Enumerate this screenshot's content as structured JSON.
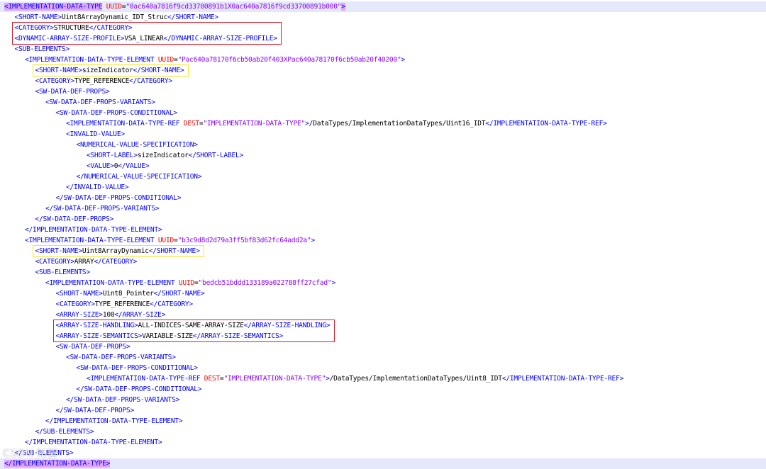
{
  "lines": [
    {
      "indent": 0,
      "highlight": true,
      "parts": [
        {
          "t": "ptag",
          "v": "<IMPLEMENTATION-DATA-TYPE"
        },
        {
          "t": "txt",
          "v": " "
        },
        {
          "t": "attr",
          "v": "UUID"
        },
        {
          "t": "eq",
          "v": "="
        },
        {
          "t": "val",
          "v": "\"0ac640a7816f9cd33700891b1X0ac640a7816f9cd33700891b000\""
        },
        {
          "t": "ptag",
          "v": ">"
        }
      ]
    },
    {
      "indent": 1,
      "parts": [
        {
          "t": "tag",
          "v": "<SHORT-NAME>"
        },
        {
          "t": "txt",
          "v": "Uint8ArrayDynamic_IDT_Struc"
        },
        {
          "t": "tag",
          "v": "</SHORT-NAME>"
        }
      ]
    },
    {
      "indent": 1,
      "parts": [
        {
          "t": "tag",
          "v": "<CATEGORY>"
        },
        {
          "t": "txt",
          "v": "STRUCTURE"
        },
        {
          "t": "tag",
          "v": "</CATEGORY>"
        }
      ]
    },
    {
      "indent": 1,
      "parts": [
        {
          "t": "tag",
          "v": "<DYNAMIC-ARRAY-SIZE-PROFILE>"
        },
        {
          "t": "txt",
          "v": "VSA_LINEAR"
        },
        {
          "t": "tag",
          "v": "</DYNAMIC-ARRAY-SIZE-PROFILE>"
        }
      ]
    },
    {
      "indent": 1,
      "parts": [
        {
          "t": "tag",
          "v": "<SUB-ELEMENTS>"
        }
      ]
    },
    {
      "indent": 2,
      "parts": [
        {
          "t": "tag",
          "v": "<IMPLEMENTATION-DATA-TYPE-ELEMENT"
        },
        {
          "t": "txt",
          "v": " "
        },
        {
          "t": "attr",
          "v": "UUID"
        },
        {
          "t": "eq",
          "v": "="
        },
        {
          "t": "val",
          "v": "\"Pac640a78170f6cb50ab20f403XPac640a78170f6cb50ab20f40200\""
        },
        {
          "t": "tag",
          "v": ">"
        }
      ]
    },
    {
      "indent": 3,
      "parts": [
        {
          "t": "tag",
          "v": "<SHORT-NAME>"
        },
        {
          "t": "txt",
          "v": "sizeIndicator"
        },
        {
          "t": "tag",
          "v": "</SHORT-NAME>"
        }
      ]
    },
    {
      "indent": 3,
      "parts": [
        {
          "t": "tag",
          "v": "<CATEGORY>"
        },
        {
          "t": "txt",
          "v": "TYPE_REFERENCE"
        },
        {
          "t": "tag",
          "v": "</CATEGORY>"
        }
      ]
    },
    {
      "indent": 3,
      "parts": [
        {
          "t": "tag",
          "v": "<SW-DATA-DEF-PROPS>"
        }
      ]
    },
    {
      "indent": 4,
      "parts": [
        {
          "t": "tag",
          "v": "<SW-DATA-DEF-PROPS-VARIANTS>"
        }
      ]
    },
    {
      "indent": 5,
      "parts": [
        {
          "t": "tag",
          "v": "<SW-DATA-DEF-PROPS-CONDITIONAL>"
        }
      ]
    },
    {
      "indent": 6,
      "parts": [
        {
          "t": "tag",
          "v": "<IMPLEMENTATION-DATA-TYPE-REF"
        },
        {
          "t": "txt",
          "v": " "
        },
        {
          "t": "attr",
          "v": "DEST"
        },
        {
          "t": "eq",
          "v": "="
        },
        {
          "t": "val",
          "v": "\"IMPLEMENTATION-DATA-TYPE\""
        },
        {
          "t": "tag",
          "v": ">"
        },
        {
          "t": "txt",
          "v": "/DataTypes/ImplementationDataTypes/Uint16_IDT"
        },
        {
          "t": "tag",
          "v": "</IMPLEMENTATION-DATA-TYPE-REF>"
        }
      ]
    },
    {
      "indent": 6,
      "parts": [
        {
          "t": "tag",
          "v": "<INVALID-VALUE>"
        }
      ]
    },
    {
      "indent": 7,
      "parts": [
        {
          "t": "tag",
          "v": "<NUMERICAL-VALUE-SPECIFICATION>"
        }
      ]
    },
    {
      "indent": 8,
      "parts": [
        {
          "t": "tag",
          "v": "<SHORT-LABEL>"
        },
        {
          "t": "txt",
          "v": "sizeIndicator"
        },
        {
          "t": "tag",
          "v": "</SHORT-LABEL>"
        }
      ]
    },
    {
      "indent": 8,
      "parts": [
        {
          "t": "tag",
          "v": "<VALUE>"
        },
        {
          "t": "txt",
          "v": "0"
        },
        {
          "t": "tag",
          "v": "</VALUE>"
        }
      ]
    },
    {
      "indent": 7,
      "parts": [
        {
          "t": "tag",
          "v": "</NUMERICAL-VALUE-SPECIFICATION>"
        }
      ]
    },
    {
      "indent": 6,
      "parts": [
        {
          "t": "tag",
          "v": "</INVALID-VALUE>"
        }
      ]
    },
    {
      "indent": 5,
      "parts": [
        {
          "t": "tag",
          "v": "</SW-DATA-DEF-PROPS-CONDITIONAL>"
        }
      ]
    },
    {
      "indent": 4,
      "parts": [
        {
          "t": "tag",
          "v": "</SW-DATA-DEF-PROPS-VARIANTS>"
        }
      ]
    },
    {
      "indent": 3,
      "parts": [
        {
          "t": "tag",
          "v": "</SW-DATA-DEF-PROPS>"
        }
      ]
    },
    {
      "indent": 2,
      "parts": [
        {
          "t": "tag",
          "v": "</IMPLEMENTATION-DATA-TYPE-ELEMENT>"
        }
      ]
    },
    {
      "indent": 2,
      "parts": [
        {
          "t": "tag",
          "v": "<IMPLEMENTATION-DATA-TYPE-ELEMENT"
        },
        {
          "t": "txt",
          "v": " "
        },
        {
          "t": "attr",
          "v": "UUID"
        },
        {
          "t": "eq",
          "v": "="
        },
        {
          "t": "val",
          "v": "\"b3c9d8d2d79a3ff5bf83d62fc64add2a\""
        },
        {
          "t": "tag",
          "v": ">"
        }
      ]
    },
    {
      "indent": 3,
      "parts": [
        {
          "t": "tag",
          "v": "<SHORT-NAME>"
        },
        {
          "t": "txt",
          "v": "Uint8ArrayDynamic"
        },
        {
          "t": "tag",
          "v": "</SHORT-NAME>"
        }
      ]
    },
    {
      "indent": 3,
      "parts": [
        {
          "t": "tag",
          "v": "<CATEGORY>"
        },
        {
          "t": "txt",
          "v": "ARRAY"
        },
        {
          "t": "tag",
          "v": "</CATEGORY>"
        }
      ]
    },
    {
      "indent": 3,
      "parts": [
        {
          "t": "tag",
          "v": "<SUB-ELEMENTS>"
        }
      ]
    },
    {
      "indent": 4,
      "parts": [
        {
          "t": "tag",
          "v": "<IMPLEMENTATION-DATA-TYPE-ELEMENT"
        },
        {
          "t": "txt",
          "v": " "
        },
        {
          "t": "attr",
          "v": "UUID"
        },
        {
          "t": "eq",
          "v": "="
        },
        {
          "t": "val",
          "v": "\"bedcb51bddd133189a022788ff27cfad\""
        },
        {
          "t": "tag",
          "v": ">"
        }
      ]
    },
    {
      "indent": 5,
      "parts": [
        {
          "t": "tag",
          "v": "<SHORT-NAME>"
        },
        {
          "t": "txt",
          "v": "Uint8_Pointer"
        },
        {
          "t": "tag",
          "v": "</SHORT-NAME>"
        }
      ]
    },
    {
      "indent": 5,
      "parts": [
        {
          "t": "tag",
          "v": "<CATEGORY>"
        },
        {
          "t": "txt",
          "v": "TYPE_REFERENCE"
        },
        {
          "t": "tag",
          "v": "</CATEGORY>"
        }
      ]
    },
    {
      "indent": 5,
      "parts": [
        {
          "t": "tag",
          "v": "<ARRAY-SIZE>"
        },
        {
          "t": "txt",
          "v": "100"
        },
        {
          "t": "tag",
          "v": "</ARRAY-SIZE>"
        }
      ]
    },
    {
      "indent": 5,
      "parts": [
        {
          "t": "tag",
          "v": "<ARRAY-SIZE-HANDLING>"
        },
        {
          "t": "txt",
          "v": "ALL-INDICES-SAME-ARRAY-SIZE"
        },
        {
          "t": "tag",
          "v": "</ARRAY-SIZE-HANDLING>"
        }
      ]
    },
    {
      "indent": 5,
      "parts": [
        {
          "t": "tag",
          "v": "<ARRAY-SIZE-SEMANTICS>"
        },
        {
          "t": "txt",
          "v": "VARIABLE-SIZE"
        },
        {
          "t": "tag",
          "v": "</ARRAY-SIZE-SEMANTICS>"
        }
      ]
    },
    {
      "indent": 5,
      "parts": [
        {
          "t": "tag",
          "v": "<SW-DATA-DEF-PROPS>"
        }
      ]
    },
    {
      "indent": 6,
      "parts": [
        {
          "t": "tag",
          "v": "<SW-DATA-DEF-PROPS-VARIANTS>"
        }
      ]
    },
    {
      "indent": 7,
      "parts": [
        {
          "t": "tag",
          "v": "<SW-DATA-DEF-PROPS-CONDITIONAL>"
        }
      ]
    },
    {
      "indent": 8,
      "parts": [
        {
          "t": "tag",
          "v": "<IMPLEMENTATION-DATA-TYPE-REF"
        },
        {
          "t": "txt",
          "v": " "
        },
        {
          "t": "attr",
          "v": "DEST"
        },
        {
          "t": "eq",
          "v": "="
        },
        {
          "t": "val",
          "v": "\"IMPLEMENTATION-DATA-TYPE\""
        },
        {
          "t": "tag",
          "v": ">"
        },
        {
          "t": "txt",
          "v": "/DataTypes/ImplementationDataTypes/Uint8_IDT"
        },
        {
          "t": "tag",
          "v": "</IMPLEMENTATION-DATA-TYPE-REF>"
        }
      ]
    },
    {
      "indent": 7,
      "parts": [
        {
          "t": "tag",
          "v": "</SW-DATA-DEF-PROPS-CONDITIONAL>"
        }
      ]
    },
    {
      "indent": 6,
      "parts": [
        {
          "t": "tag",
          "v": "</SW-DATA-DEF-PROPS-VARIANTS>"
        }
      ]
    },
    {
      "indent": 5,
      "parts": [
        {
          "t": "tag",
          "v": "</SW-DATA-DEF-PROPS>"
        }
      ]
    },
    {
      "indent": 4,
      "parts": [
        {
          "t": "tag",
          "v": "</IMPLEMENTATION-DATA-TYPE-ELEMENT>"
        }
      ]
    },
    {
      "indent": 3,
      "parts": [
        {
          "t": "tag",
          "v": "</SUB-ELEMENTS>"
        }
      ]
    },
    {
      "indent": 2,
      "parts": [
        {
          "t": "tag",
          "v": "</IMPLEMENTATION-DATA-TYPE-ELEMENT>"
        }
      ]
    },
    {
      "indent": 1,
      "parts": [
        {
          "t": "tag",
          "v": "</SUB-ELEMENTS>"
        }
      ]
    },
    {
      "indent": 0,
      "highlight": true,
      "parts": [
        {
          "t": "ptag",
          "v": "</IMPLEMENTATION-DATA-TYPE>"
        }
      ]
    }
  ],
  "watermark": "CSDN 知智",
  "colors": {
    "tag": "#0000ff",
    "attribute": "#ff0000",
    "attribute_value": "#8b00ff",
    "text": "#000000",
    "root_tag_highlight": "#e0a6ff",
    "line_highlight": "#e5e7fb",
    "red_box": "#d81c2a",
    "yellow_box": "#f5e626"
  },
  "annotations": [
    {
      "color": "red",
      "first_line": 2,
      "last_line": 3
    },
    {
      "color": "yellow",
      "first_line": 6,
      "last_line": 6
    },
    {
      "color": "yellow",
      "first_line": 23,
      "last_line": 23
    },
    {
      "color": "red",
      "first_line": 30,
      "last_line": 31
    }
  ]
}
